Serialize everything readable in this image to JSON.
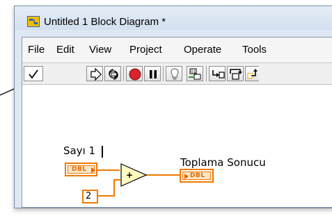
{
  "window": {
    "title": "Untitled 1 Block Diagram *"
  },
  "menu": {
    "items": [
      "File",
      "Edit",
      "View",
      "Project",
      "Operate",
      "Tools"
    ]
  },
  "toolbar": {
    "buttons": [
      {
        "icon": "checkmark-icon"
      },
      {
        "icon": "run-arrow-icon"
      },
      {
        "icon": "run-continuously-icon"
      },
      {
        "icon": "abort-icon"
      },
      {
        "icon": "pause-icon"
      },
      {
        "icon": "highlight-execution-icon"
      },
      {
        "icon": "retain-wire-values-icon"
      },
      {
        "icon": "step-into-icon"
      },
      {
        "icon": "step-over-icon"
      },
      {
        "icon": "step-out-icon"
      }
    ]
  },
  "diagram": {
    "control_label": "Sayı 1",
    "control_type": "DBL",
    "indicator_label": "Toplama Sonucu",
    "indicator_type": "DBL",
    "constant_value": "2",
    "add_symbol": "+"
  },
  "colors": {
    "wire": "#f07800",
    "terminal_fill": "#fbe6c8",
    "add_fill": "#fffac0",
    "titlebar": "#d3e0ef"
  }
}
